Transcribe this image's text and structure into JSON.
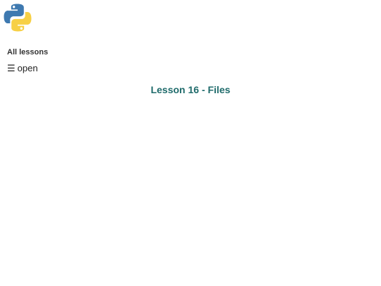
{
  "header": {
    "logo_icon": "python-logo-icon",
    "all_lessons_label": "All lessons"
  },
  "menu": {
    "icon": "hamburger-menu-icon",
    "icon_glyph": "☰",
    "label": "open"
  },
  "main": {
    "title": "Lesson 16 - Files"
  },
  "colors": {
    "title": "#1f6b6b",
    "python_blue": "#3e79b0",
    "python_yellow": "#f7d046"
  }
}
